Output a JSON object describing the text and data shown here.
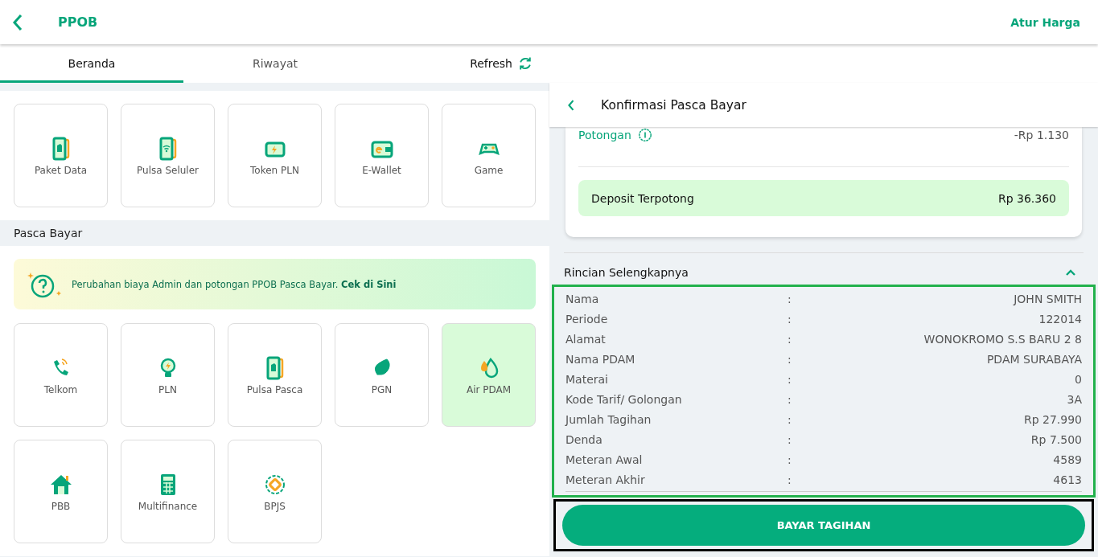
{
  "app_bar": {
    "title": "PPOB",
    "action": "Atur Harga"
  },
  "tabs": [
    {
      "label": "Beranda",
      "selected": true
    },
    {
      "label": "Riwayat",
      "selected": false
    }
  ],
  "refresh": {
    "label": "Refresh"
  },
  "prepaid": {
    "items": [
      {
        "label": "Paket Data",
        "kind": "sim",
        "selected": false
      },
      {
        "label": "Pulsa Seluler",
        "kind": "phone",
        "selected": false
      },
      {
        "label": "Token PLN",
        "kind": "token",
        "selected": false
      },
      {
        "label": "E-Wallet",
        "kind": "wallet",
        "selected": false
      },
      {
        "label": "Game",
        "kind": "game",
        "selected": false
      }
    ]
  },
  "postpaid": {
    "title": "Pasca Bayar",
    "notice": "Perubahan biaya Admin dan potongan PPOB Pasca Bayar. **Cek di Sini**",
    "items": [
      {
        "label": "Telkom",
        "kind": "telephone",
        "selected": false
      },
      {
        "label": "PLN",
        "kind": "bulb",
        "selected": false
      },
      {
        "label": "Pulsa Pasca",
        "kind": "sim",
        "selected": false
      },
      {
        "label": "PGN",
        "kind": "gas",
        "selected": false
      },
      {
        "label": "Air PDAM",
        "kind": "water",
        "selected": true
      },
      {
        "label": "PBB",
        "kind": "house",
        "selected": false
      },
      {
        "label": "Multifinance",
        "kind": "calculator",
        "selected": false
      },
      {
        "label": "BPJS",
        "kind": "badge",
        "selected": false
      }
    ]
  },
  "confirmation": {
    "title": "Konfirmasi Pasca Bayar",
    "discount": {
      "label": "Potongan",
      "value": "-Rp 1.130"
    },
    "deposit": {
      "label": "Deposit Terpotong",
      "value": "Rp 36.360"
    },
    "details_title": "Rincian Selengkapnya",
    "expanded": true,
    "highlighted": true,
    "details": [
      {
        "label": "Nama",
        "separator": ":",
        "value": "JOHN SMITH"
      },
      {
        "label": "Periode",
        "separator": ":",
        "value": "122014"
      },
      {
        "label": "Alamat",
        "separator": ":",
        "value": "WONOKROMO S.S BARU 2 8"
      },
      {
        "label": "Nama PDAM",
        "separator": ":",
        "value": "PDAM SURABAYA"
      },
      {
        "label": "Materai",
        "separator": ":",
        "value": "0"
      },
      {
        "label": "Kode Tarif/ Golongan",
        "separator": ":",
        "value": "3A"
      },
      {
        "label": "Jumlah Tagihan",
        "separator": ":",
        "value": "Rp 27.990"
      },
      {
        "label": "Denda",
        "separator": ":",
        "value": "Rp 7.500"
      },
      {
        "label": "Meteran Awal",
        "separator": ":",
        "value": "4589"
      },
      {
        "label": "Meteran Akhir",
        "separator": ":",
        "value": "4613"
      }
    ],
    "pay_button": {
      "label": "BAYAR TAGIHAN",
      "highlighted": true
    }
  }
}
